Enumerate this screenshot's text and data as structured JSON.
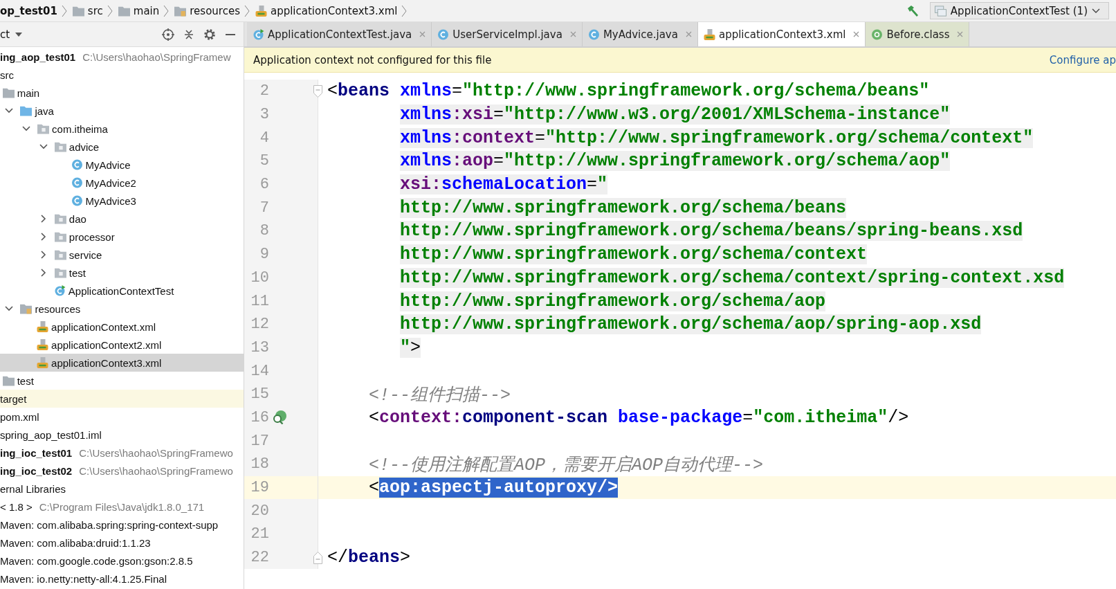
{
  "breadcrumbs": [
    {
      "label": "op_test01"
    },
    {
      "label": "src"
    },
    {
      "label": "main"
    },
    {
      "label": "resources"
    },
    {
      "label": "applicationContext3.xml"
    }
  ],
  "run_config": {
    "label": "ApplicationContextTest (1)"
  },
  "project_panel": {
    "title": "ct",
    "tree": [
      {
        "label": "ing_aop_test01",
        "path": "C:\\Users\\haohao\\SpringFramew",
        "kind": "module",
        "selected": false,
        "children": [
          {
            "label": "src",
            "kind": "folder",
            "selected": false,
            "children": [
              {
                "label": "main",
                "kind": "folder",
                "selected": false,
                "children": [
                  {
                    "label": "java",
                    "kind": "source-folder",
                    "expanded": true,
                    "selected": false,
                    "children": [
                      {
                        "label": "com.itheima",
                        "kind": "package",
                        "expanded": true,
                        "selected": false,
                        "children": [
                          {
                            "label": "advice",
                            "kind": "package",
                            "expanded": true,
                            "selected": false,
                            "children": [
                              {
                                "label": "MyAdvice",
                                "kind": "class",
                                "selected": false
                              },
                              {
                                "label": "MyAdvice2",
                                "kind": "class",
                                "selected": false
                              },
                              {
                                "label": "MyAdvice3",
                                "kind": "class",
                                "selected": false
                              }
                            ]
                          },
                          {
                            "label": "dao",
                            "kind": "package",
                            "expanded": false,
                            "selected": false
                          },
                          {
                            "label": "processor",
                            "kind": "package",
                            "expanded": false,
                            "selected": false
                          },
                          {
                            "label": "service",
                            "kind": "package",
                            "expanded": false,
                            "selected": false
                          },
                          {
                            "label": "test",
                            "kind": "package",
                            "expanded": false,
                            "selected": false
                          },
                          {
                            "label": "ApplicationContextTest",
                            "kind": "test-class",
                            "selected": false
                          }
                        ]
                      }
                    ]
                  },
                  {
                    "label": "resources",
                    "kind": "resources-folder",
                    "expanded": true,
                    "selected": false,
                    "children": [
                      {
                        "label": "applicationContext.xml",
                        "kind": "xml",
                        "selected": false
                      },
                      {
                        "label": "applicationContext2.xml",
                        "kind": "xml",
                        "selected": false
                      },
                      {
                        "label": "applicationContext3.xml",
                        "kind": "xml",
                        "selected": true
                      }
                    ]
                  }
                ]
              },
              {
                "label": "test",
                "kind": "folder",
                "selected": false
              }
            ]
          },
          {
            "label": "target",
            "kind": "excluded-folder",
            "selected": false
          },
          {
            "label": "pom.xml",
            "kind": "file",
            "selected": false
          },
          {
            "label": "spring_aop_test01.iml",
            "kind": "file",
            "selected": false
          }
        ]
      },
      {
        "label": "ing_ioc_test01",
        "path": "C:\\Users\\haohao\\SpringFramewo",
        "kind": "module",
        "selected": false
      },
      {
        "label": "ing_ioc_test02",
        "path": "C:\\Users\\haohao\\SpringFramewo",
        "kind": "module",
        "selected": false
      },
      {
        "label": "ernal Libraries",
        "kind": "libraries",
        "selected": false,
        "children": [
          {
            "label": "< 1.8 >",
            "path": "C:\\Program Files\\Java\\jdk1.8.0_171",
            "kind": "jdk",
            "selected": false
          },
          {
            "label": "Maven: com.alibaba.spring:spring-context-supp",
            "kind": "library",
            "selected": false
          },
          {
            "label": "Maven: com.alibaba:druid:1.1.23",
            "kind": "library",
            "selected": false
          },
          {
            "label": "Maven: com.google.code.gson:gson:2.8.5",
            "kind": "library",
            "selected": false
          },
          {
            "label": "Maven: io.netty:netty-all:4.1.25.Final",
            "kind": "library",
            "selected": false
          }
        ]
      }
    ]
  },
  "tabs": [
    {
      "label": "ApplicationContextTest.java",
      "kind": "test-class",
      "selected": false
    },
    {
      "label": "UserServiceImpl.java",
      "kind": "class",
      "selected": false
    },
    {
      "label": "MyAdvice.java",
      "kind": "class",
      "selected": false
    },
    {
      "label": "applicationContext3.xml",
      "kind": "xml",
      "selected": true
    },
    {
      "label": "Before.class",
      "kind": "annotation",
      "selected": false
    }
  ],
  "notification": {
    "message": "Application context not configured for this file",
    "link": "Configure ap"
  },
  "editor": {
    "lines": [
      {
        "number": "2",
        "kind": "open-tag",
        "current": false,
        "tokens": [
          {
            "kind": "bracket",
            "text": "<"
          },
          {
            "kind": "tag",
            "text": "beans"
          },
          {
            "kind": "attr",
            "text": "xmlns"
          },
          {
            "kind": "plain",
            "text": "="
          },
          {
            "kind": "value",
            "text": "\"http://www.springframework.org/schema/beans\""
          }
        ]
      },
      {
        "number": "3",
        "kind": "attribute",
        "current": false,
        "tokens": [
          {
            "kind": "attr",
            "text": "xmlns"
          },
          {
            "kind": "ns",
            "text": ":xsi"
          },
          {
            "kind": "plain",
            "text": "="
          },
          {
            "kind": "value",
            "text": "\"http://www.w3.org/2001/XMLSchema-instance\""
          }
        ]
      },
      {
        "number": "4",
        "kind": "attribute",
        "current": false,
        "tokens": [
          {
            "kind": "attr",
            "text": "xmlns"
          },
          {
            "kind": "ns",
            "text": ":context"
          },
          {
            "kind": "plain",
            "text": "="
          },
          {
            "kind": "value",
            "text": "\"http://www.springframework.org/schema/context\""
          }
        ]
      },
      {
        "number": "5",
        "kind": "attribute",
        "current": false,
        "tokens": [
          {
            "kind": "attr",
            "text": "xmlns"
          },
          {
            "kind": "ns",
            "text": ":aop"
          },
          {
            "kind": "plain",
            "text": "="
          },
          {
            "kind": "value",
            "text": "\"http://www.springframework.org/schema/aop\""
          }
        ]
      },
      {
        "number": "6",
        "kind": "attribute",
        "current": false,
        "tokens": [
          {
            "kind": "ns",
            "text": "xsi:"
          },
          {
            "kind": "attr",
            "text": "schemaLocation"
          },
          {
            "kind": "plain",
            "text": "="
          },
          {
            "kind": "value",
            "text": "\""
          }
        ]
      },
      {
        "number": "7",
        "kind": "attribute",
        "current": false,
        "tokens": [
          {
            "kind": "value",
            "text": "http://www.springframework.org/schema/beans"
          }
        ]
      },
      {
        "number": "8",
        "kind": "attribute",
        "current": false,
        "tokens": [
          {
            "kind": "value",
            "text": "http://www.springframework.org/schema/beans/spring-beans.xsd"
          }
        ]
      },
      {
        "number": "9",
        "kind": "attribute",
        "current": false,
        "tokens": [
          {
            "kind": "value",
            "text": "http://www.springframework.org/schema/context"
          }
        ]
      },
      {
        "number": "10",
        "kind": "attribute",
        "current": false,
        "tokens": [
          {
            "kind": "value",
            "text": "http://www.springframework.org/schema/context/spring-context.xsd"
          }
        ]
      },
      {
        "number": "11",
        "kind": "attribute",
        "current": false,
        "tokens": [
          {
            "kind": "value",
            "text": "http://www.springframework.org/schema/aop"
          }
        ]
      },
      {
        "number": "12",
        "kind": "attribute",
        "current": false,
        "tokens": [
          {
            "kind": "value",
            "text": "http://www.springframework.org/schema/aop/spring-aop.xsd"
          }
        ]
      },
      {
        "number": "13",
        "kind": "attribute",
        "current": false,
        "tokens": [
          {
            "kind": "value",
            "text": "\""
          },
          {
            "kind": "bracket",
            "text": ">"
          }
        ]
      },
      {
        "number": "14",
        "kind": "blank",
        "current": false
      },
      {
        "number": "15",
        "kind": "comment",
        "current": false,
        "tokens": [
          {
            "kind": "comment",
            "text": "<!--组件扫描-->"
          }
        ]
      },
      {
        "number": "16",
        "kind": "bean-tag",
        "current": false,
        "tokens": [
          {
            "kind": "bracket",
            "text": "<"
          },
          {
            "kind": "ns",
            "text": "context:"
          },
          {
            "kind": "tag",
            "text": "component-scan"
          },
          {
            "kind": "attr",
            "text": "base-package"
          },
          {
            "kind": "plain",
            "text": "="
          },
          {
            "kind": "value",
            "text": "\"com.itheima\""
          },
          {
            "kind": "bracket",
            "text": "/>"
          }
        ]
      },
      {
        "number": "17",
        "kind": "blank",
        "current": false
      },
      {
        "number": "18",
        "kind": "comment",
        "current": false,
        "tokens": [
          {
            "kind": "comment",
            "text": "<!--使用注解配置AOP，需要开启AOP自动代理-->"
          }
        ]
      },
      {
        "number": "19",
        "kind": "tag",
        "current": true,
        "tokens": [
          {
            "kind": "bracket",
            "text": "<"
          },
          {
            "kind": "selection",
            "text": "aop:aspectj-autoproxy/>"
          }
        ]
      },
      {
        "number": "20",
        "kind": "blank",
        "current": false
      },
      {
        "number": "21",
        "kind": "blank",
        "current": false
      },
      {
        "number": "22",
        "kind": "close-tag",
        "current": false,
        "tokens": [
          {
            "kind": "bracket",
            "text": "</"
          },
          {
            "kind": "tag",
            "text": "beans"
          },
          {
            "kind": "bracket",
            "text": ">"
          }
        ]
      }
    ]
  }
}
